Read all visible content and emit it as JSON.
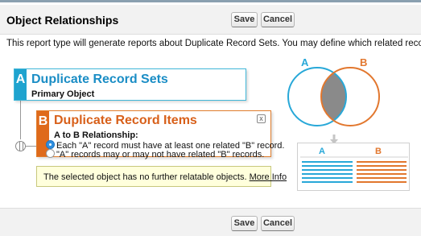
{
  "header": {
    "title": "Object Relationships",
    "save_label": "Save",
    "cancel_label": "Cancel"
  },
  "intro_text": "This report type will generate reports about Duplicate Record Sets. You may define which related records from other objects",
  "object_a": {
    "letter": "A",
    "name": "Duplicate Record Sets",
    "subtitle": "Primary Object"
  },
  "object_b": {
    "letter": "B",
    "name": "Duplicate Record Items",
    "close_label": "x",
    "relationship_label": "A to B Relationship:",
    "options": [
      {
        "label": "Each \"A\" record must have at least one related \"B\" record.",
        "selected": true
      },
      {
        "label": "\"A\" records may or may not have related \"B\" records.",
        "selected": false
      }
    ]
  },
  "info_box": {
    "text": "The selected object has no further relatable objects.",
    "link": "More Info"
  },
  "illustration": {
    "venn_label_a": "A",
    "venn_label_b": "B",
    "table_header_a": "A",
    "table_header_b": "B",
    "colors": {
      "a": "#28a8d8",
      "b": "#e2772e",
      "overlap": "#8a8a8a"
    }
  },
  "footer": {
    "save_label": "Save",
    "cancel_label": "Cancel"
  }
}
